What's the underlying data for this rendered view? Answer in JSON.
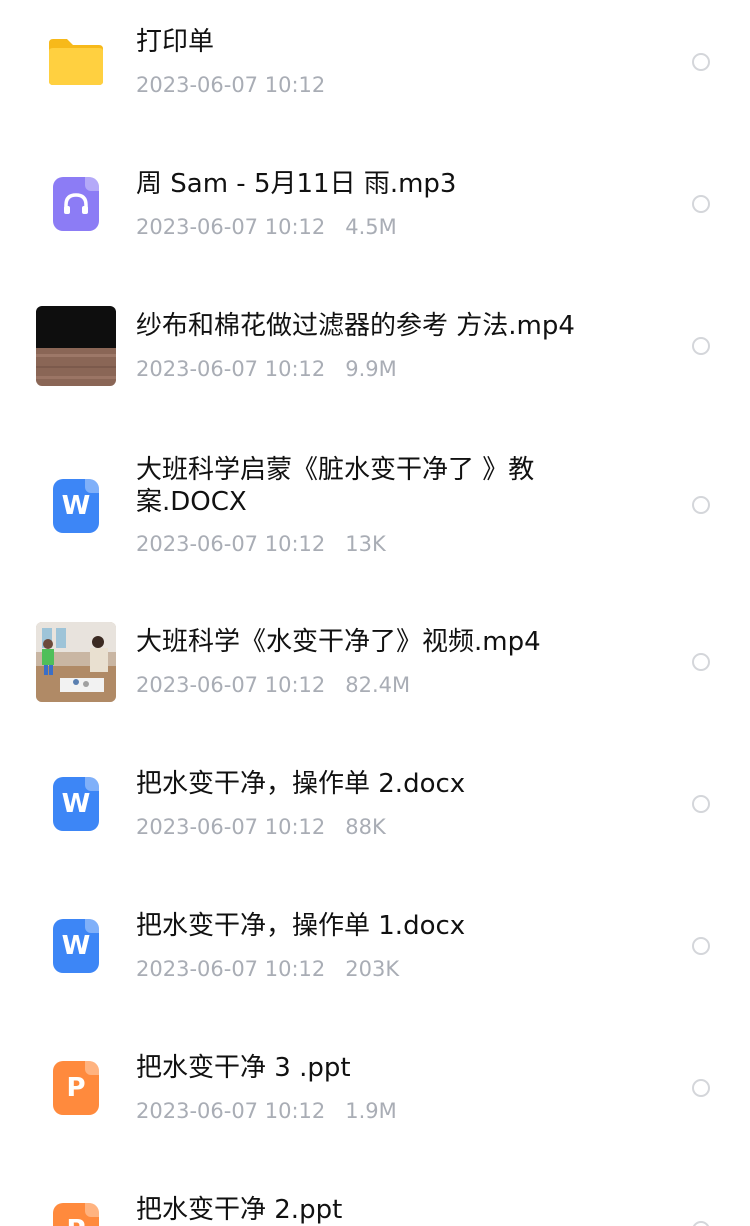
{
  "files": [
    {
      "name": "打印单",
      "date": "2023-06-07 10:12",
      "size": "",
      "type": "folder"
    },
    {
      "name": "周 Sam - 5月11日 雨.mp3",
      "date": "2023-06-07 10:12",
      "size": "4.5M",
      "type": "audio"
    },
    {
      "name": "纱布和棉花做过滤器的参考 方法.mp4",
      "date": "2023-06-07 10:12",
      "size": "9.9M",
      "type": "video-dark"
    },
    {
      "name": "大班科学启蒙《脏水变干净了 》教案.DOCX",
      "date": "2023-06-07 10:12",
      "size": "13K",
      "type": "word"
    },
    {
      "name": "大班科学《水变干净了》视频.mp4",
      "date": "2023-06-07 10:12",
      "size": "82.4M",
      "type": "video-class"
    },
    {
      "name": "把水变干净，操作单 2.docx",
      "date": "2023-06-07 10:12",
      "size": "88K",
      "type": "word"
    },
    {
      "name": "把水变干净，操作单 1.docx",
      "date": "2023-06-07 10:12",
      "size": "203K",
      "type": "word"
    },
    {
      "name": "把水变干净 3 .ppt",
      "date": "2023-06-07 10:12",
      "size": "1.9M",
      "type": "ppt"
    },
    {
      "name": "把水变干净 2.ppt",
      "date": "",
      "size": "",
      "type": "ppt"
    }
  ],
  "colors": {
    "word": "#3d86f6",
    "ppt": "#ff8a3d",
    "audio": "#8c7cf5",
    "folder": "#ffc928"
  }
}
